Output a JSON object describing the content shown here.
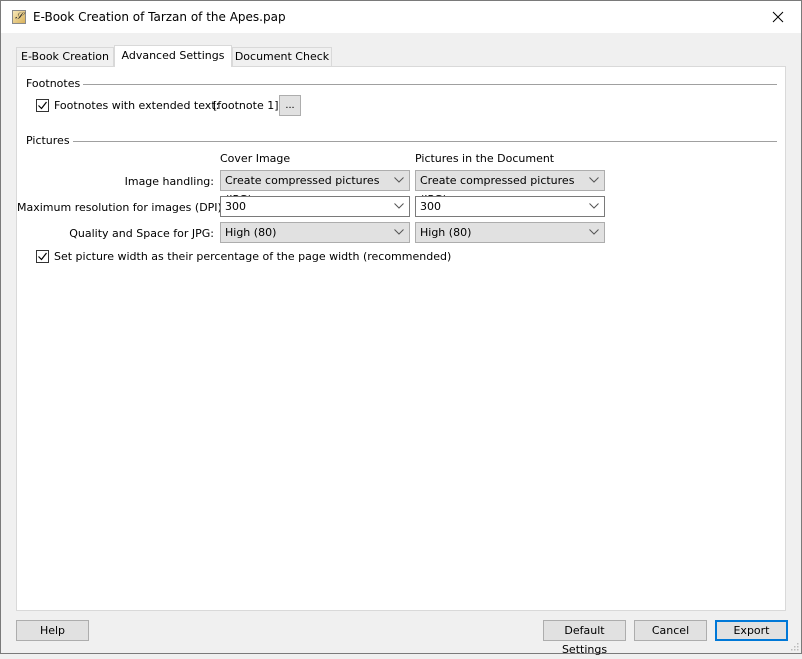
{
  "window": {
    "title": "E-Book Creation of Tarzan of the Apes.pap",
    "app_icon": "papyrus-app-icon",
    "close_icon": "close-icon"
  },
  "tabs": [
    {
      "label": "E-Book Creation",
      "active": false
    },
    {
      "label": "Advanced Settings",
      "active": true
    },
    {
      "label": "Document Check",
      "active": false
    }
  ],
  "footnotes": {
    "group_label": "Footnotes",
    "checkbox_label": "Footnotes with extended text:",
    "checked": true,
    "value": "[footnote 1]",
    "browse_label": "..."
  },
  "pictures": {
    "group_label": "Pictures",
    "column_headers": [
      "Cover Image",
      "Pictures in the Document"
    ],
    "rows": [
      {
        "label": "Image handling:",
        "cover": "Create compressed pictures (JPG)",
        "document": "Create compressed pictures (JPG)",
        "editable": false
      },
      {
        "label": "Maximum resolution for images (DPI):",
        "cover": "300",
        "document": "300",
        "editable": true
      },
      {
        "label": "Quality and Space for JPG:",
        "cover": "High (80)",
        "document": "High (80)",
        "editable": false
      }
    ],
    "width_checkbox_label": "Set picture width as their percentage of the page width (recommended)",
    "width_checked": true
  },
  "footer": {
    "help": "Help",
    "default_settings": "Default Settings",
    "cancel": "Cancel",
    "export": "Export"
  }
}
